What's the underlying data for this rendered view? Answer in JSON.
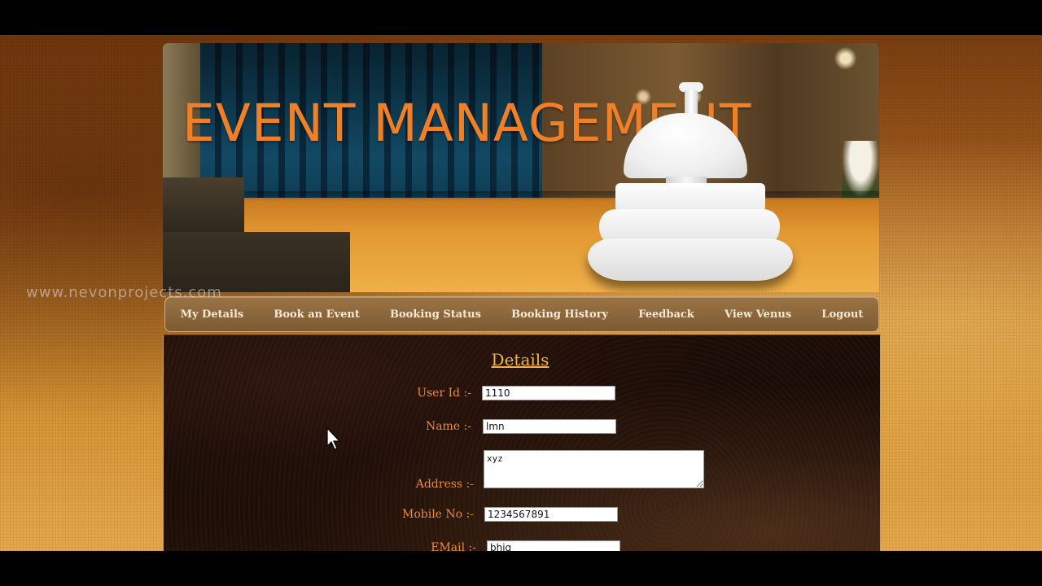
{
  "banner": {
    "title": "EVENT MANAGEMENT"
  },
  "watermark": "www.nevonprojects.com",
  "nav": {
    "items": [
      {
        "label": "My Details"
      },
      {
        "label": "Book an Event"
      },
      {
        "label": "Booking Status"
      },
      {
        "label": "Booking History"
      },
      {
        "label": "Feedback"
      },
      {
        "label": "View Venus"
      },
      {
        "label": "Logout"
      }
    ]
  },
  "details": {
    "title": "Details",
    "fields": {
      "user_id": {
        "label": "User Id :-",
        "value": "1110"
      },
      "name": {
        "label": "Name :-",
        "value": "lmn"
      },
      "address": {
        "label": "Address :-",
        "value": "xyz"
      },
      "mobile": {
        "label": "Mobile No :-",
        "value": "1234567891"
      },
      "email": {
        "label": "EMail :-",
        "value": "bhig"
      }
    }
  },
  "colors": {
    "banner_title": "#f07f26",
    "nav_bg": "#8a6638",
    "nav_text": "#f4ead8",
    "details_title": "#f0b546",
    "label_text": "#e98a3c",
    "panel_bg": "#1a0c06"
  },
  "icons": {
    "cursor": "mouse-pointer-icon",
    "bell": "service-bell-icon"
  }
}
